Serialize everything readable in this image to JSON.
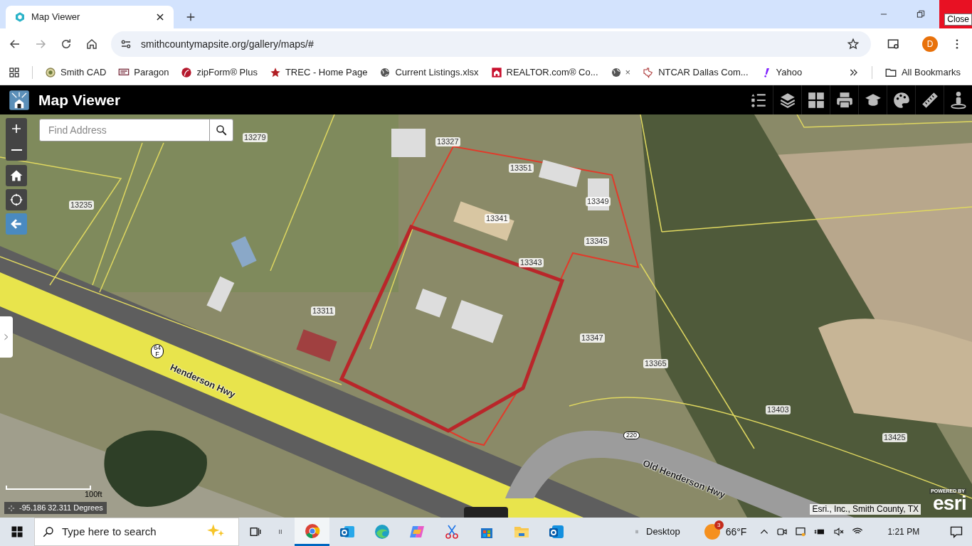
{
  "browser": {
    "tab": {
      "title": "Map Viewer",
      "selected": true
    },
    "url": "smithcountymapsite.org/gallery/maps/#",
    "profile_initial": "D",
    "tooltip": "Close",
    "bookmarks": [
      {
        "kind": "seal",
        "label": "Smith CAD"
      },
      {
        "kind": "logo",
        "label": "Paragon"
      },
      {
        "kind": "swoosh",
        "label": "zipForm® Plus"
      },
      {
        "kind": "star",
        "label": "TREC - Home Page"
      },
      {
        "kind": "globe",
        "label": "Current Listings.xlsx"
      },
      {
        "kind": "house",
        "label": "REALTOR.com® Co..."
      },
      {
        "kind": "globe-close",
        "label": "×"
      },
      {
        "kind": "texas",
        "label": "NTCAR Dallas Com..."
      },
      {
        "kind": "exclaim",
        "label": "Yahoo"
      }
    ],
    "all_bookmarks": "All Bookmarks"
  },
  "app": {
    "title": "Map Viewer",
    "tools": [
      {
        "kind": "legend"
      },
      {
        "kind": "layers"
      },
      {
        "kind": "basemap"
      },
      {
        "kind": "print"
      },
      {
        "kind": "learn"
      },
      {
        "kind": "palette"
      },
      {
        "kind": "measure"
      },
      {
        "kind": "street-view"
      }
    ]
  },
  "map": {
    "search": {
      "placeholder": "Find Address"
    },
    "parcels": [
      "13279",
      "13327",
      "13351",
      "13235",
      "13341",
      "13349",
      "13345",
      "13343",
      "13311",
      "13347",
      "13365",
      "13403",
      "13425"
    ],
    "roads": [
      {
        "kind": "road",
        "label": "Henderson Hwy"
      },
      {
        "kind": "road",
        "label": "Old Henderson Hwy"
      },
      {
        "kind": "shield",
        "label": "64\nF"
      },
      {
        "kind": "shield",
        "label": "220"
      }
    ],
    "scale": "100ft",
    "coordinates": "-95.186 32.311 Degrees",
    "attribution": "Esri., Inc., Smith County, TX",
    "powered_by": "POWERED BY",
    "esri": "esri"
  },
  "taskbar": {
    "search": {
      "placeholder": "Type here to search"
    },
    "desktop": "Desktop",
    "weather": {
      "temp": "66°F",
      "badge": "3"
    },
    "time": "1:21 PM",
    "apps": [
      {
        "kind": "chrome",
        "selected": true
      },
      {
        "kind": "outlook",
        "selected": false
      },
      {
        "kind": "edge",
        "selected": false
      },
      {
        "kind": "copilot",
        "selected": false
      },
      {
        "kind": "snip",
        "selected": false
      },
      {
        "kind": "store",
        "selected": false
      },
      {
        "kind": "folder",
        "selected": false
      },
      {
        "kind": "outlook-new",
        "selected": false
      }
    ]
  }
}
